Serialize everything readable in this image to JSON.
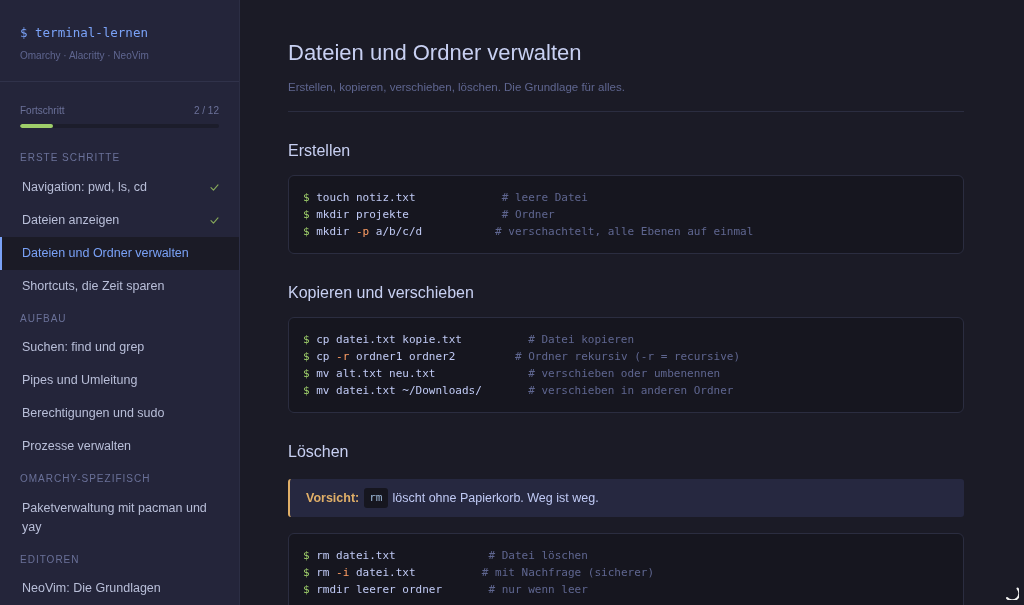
{
  "sidebar": {
    "brand": {
      "title": "$ terminal-lernen",
      "subtitle": "Omarchy · Alacritty · NeoVim"
    },
    "progress": {
      "label": "Fortschritt",
      "count": "2 / 12",
      "level": 0.167
    },
    "sections": [
      {
        "title": "ERSTE SCHRITTE",
        "items": [
          {
            "label": "Navigation: pwd, ls, cd",
            "done": true,
            "selected": false
          },
          {
            "label": "Dateien anzeigen",
            "done": true,
            "selected": false
          },
          {
            "label": "Dateien und Ordner verwalten",
            "done": false,
            "selected": true
          },
          {
            "label": "Shortcuts, die Zeit sparen",
            "done": false,
            "selected": false
          }
        ]
      },
      {
        "title": "AUFBAU",
        "items": [
          {
            "label": "Suchen: find und grep",
            "done": false,
            "selected": false
          },
          {
            "label": "Pipes und Umleitung",
            "done": false,
            "selected": false
          },
          {
            "label": "Berechtigungen und sudo",
            "done": false,
            "selected": false
          },
          {
            "label": "Prozesse verwalten",
            "done": false,
            "selected": false
          }
        ]
      },
      {
        "title": "OMARCHY-SPEZIFISCH",
        "items": [
          {
            "label": "Paketverwaltung mit pacman und yay",
            "done": false,
            "selected": false
          }
        ]
      },
      {
        "title": "EDITOREN",
        "items": [
          {
            "label": "NeoVim: Die Grundlagen",
            "done": false,
            "selected": false
          }
        ]
      }
    ]
  },
  "page": {
    "title": "Dateien und Ordner verwalten",
    "subtitle": "Erstellen, kopieren, verschieben, löschen. Die Grundlage für alles.",
    "sections": [
      {
        "heading": "Erstellen",
        "blocks": [
          {
            "kind": "code",
            "lines": [
              {
                "segments": [
                  {
                    "kind": "prompt",
                    "text": "$"
                  },
                  {
                    "kind": "command",
                    "text": "touch notiz.txt             "
                  },
                  {
                    "kind": "comment",
                    "text": "# leere Datei"
                  }
                ]
              },
              {
                "segments": [
                  {
                    "kind": "prompt",
                    "text": "$"
                  },
                  {
                    "kind": "command",
                    "text": "mkdir projekte              "
                  },
                  {
                    "kind": "comment",
                    "text": "# Ordner"
                  }
                ]
              },
              {
                "segments": [
                  {
                    "kind": "prompt",
                    "text": "$"
                  },
                  {
                    "kind": "command",
                    "text": "mkdir "
                  },
                  {
                    "kind": "flag",
                    "text": "-p"
                  },
                  {
                    "kind": "command",
                    "text": " a/b/c/d           "
                  },
                  {
                    "kind": "comment",
                    "text": "# verschachtelt, alle Ebenen auf einmal"
                  }
                ]
              }
            ]
          }
        ]
      },
      {
        "heading": "Kopieren und verschieben",
        "blocks": [
          {
            "kind": "code",
            "lines": [
              {
                "segments": [
                  {
                    "kind": "prompt",
                    "text": "$"
                  },
                  {
                    "kind": "command",
                    "text": "cp datei.txt kopie.txt          "
                  },
                  {
                    "kind": "comment",
                    "text": "# Datei kopieren"
                  }
                ]
              },
              {
                "segments": [
                  {
                    "kind": "prompt",
                    "text": "$"
                  },
                  {
                    "kind": "command",
                    "text": "cp "
                  },
                  {
                    "kind": "flag",
                    "text": "-r"
                  },
                  {
                    "kind": "command",
                    "text": " ordner1 ordner2         "
                  },
                  {
                    "kind": "comment",
                    "text": "# Ordner rekursiv (-r = recursive)"
                  }
                ]
              },
              {
                "segments": [
                  {
                    "kind": "prompt",
                    "text": "$"
                  },
                  {
                    "kind": "command",
                    "text": "mv alt.txt neu.txt              "
                  },
                  {
                    "kind": "comment",
                    "text": "# verschieben oder umbenennen"
                  }
                ]
              },
              {
                "segments": [
                  {
                    "kind": "prompt",
                    "text": "$"
                  },
                  {
                    "kind": "command",
                    "text": "mv datei.txt ~/Downloads/       "
                  },
                  {
                    "kind": "comment",
                    "text": "# verschieben in anderen Ordner"
                  }
                ]
              }
            ]
          }
        ]
      },
      {
        "heading": "Löschen",
        "blocks": [
          {
            "kind": "callout",
            "label": "Vorsicht:",
            "code": "rm",
            "text": "löscht ohne Papierkorb. Weg ist weg."
          },
          {
            "kind": "code",
            "lines": [
              {
                "segments": [
                  {
                    "kind": "prompt",
                    "text": "$"
                  },
                  {
                    "kind": "command",
                    "text": "rm datei.txt              "
                  },
                  {
                    "kind": "comment",
                    "text": "# Datei löschen"
                  }
                ]
              },
              {
                "segments": [
                  {
                    "kind": "prompt",
                    "text": "$"
                  },
                  {
                    "kind": "command",
                    "text": "rm "
                  },
                  {
                    "kind": "flag",
                    "text": "-i"
                  },
                  {
                    "kind": "command",
                    "text": " datei.txt          "
                  },
                  {
                    "kind": "comment",
                    "text": "# mit Nachfrage (sicherer)"
                  }
                ]
              },
              {
                "segments": [
                  {
                    "kind": "prompt",
                    "text": "$"
                  },
                  {
                    "kind": "command",
                    "text": "rmdir leerer ordner       "
                  },
                  {
                    "kind": "comment",
                    "text": "# nur wenn leer"
                  }
                ]
              }
            ]
          }
        ]
      }
    ]
  }
}
